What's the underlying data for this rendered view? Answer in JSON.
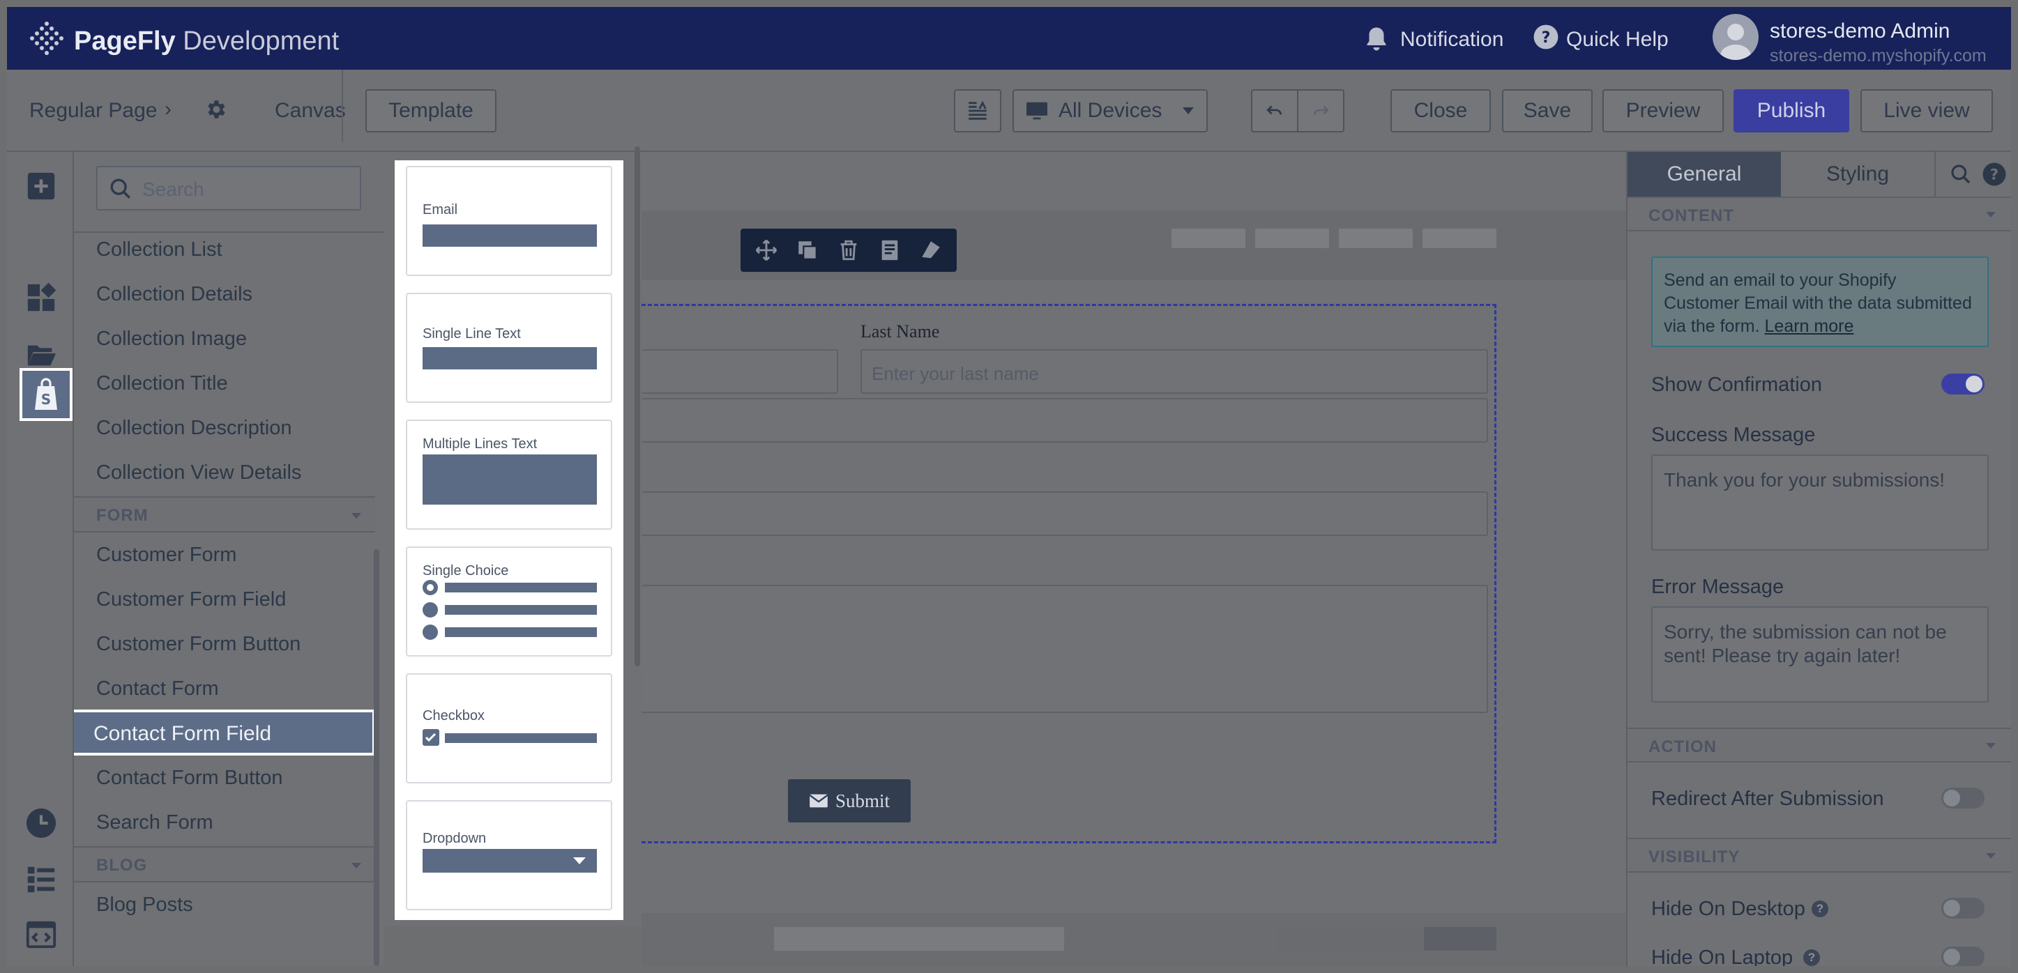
{
  "topbar": {
    "brand_bold": "PageFly",
    "brand_light": "Development",
    "notification_label": "Notification",
    "quick_help_label": "Quick Help",
    "user_name": "stores-demo Admin",
    "user_store": "stores-demo.myshopify.com"
  },
  "toolbar": {
    "breadcrumb_page": "Regular Page",
    "breadcrumb_separator": "›",
    "breadcrumb_canvas": "Canvas",
    "template_label": "Template",
    "devices_label": "All Devices",
    "close_label": "Close",
    "save_label": "Save",
    "preview_label": "Preview",
    "publish_label": "Publish",
    "live_view_label": "Live view"
  },
  "element_panel": {
    "search_placeholder": "Search",
    "items_top": [
      "Collection List",
      "Collection Details",
      "Collection Image",
      "Collection Title",
      "Collection Description",
      "Collection View Details"
    ],
    "form_section": "FORM",
    "form_items": [
      "Customer Form",
      "Customer Form Field",
      "Customer Form Button",
      "Contact Form",
      "Contact Form Field",
      "Contact Form Button",
      "Search Form"
    ],
    "selected_item": "Contact Form Field",
    "blog_section": "BLOG",
    "blog_items": [
      "Blog Posts"
    ]
  },
  "field_picker": {
    "cards": [
      "Email",
      "Single Line Text",
      "Multiple Lines Text",
      "Single Choice",
      "Checkbox",
      "Dropdown"
    ]
  },
  "canvas": {
    "last_name_label": "Last Name",
    "last_name_placeholder": "Enter your last name",
    "submit_label": "Submit"
  },
  "right_panel": {
    "tab_general": "General",
    "tab_styling": "Styling",
    "content_section": "CONTENT",
    "info_text": "Send an email to your Shopify Customer Email with the data submitted via the form.",
    "info_link": "Learn more",
    "show_confirmation_label": "Show Confirmation",
    "show_confirmation_on": true,
    "success_message_label": "Success Message",
    "success_message_value": "Thank you for your submissions!",
    "error_message_label": "Error Message",
    "error_message_value": "Sorry, the submission can not be sent! Please try again later!",
    "action_section": "ACTION",
    "redirect_label": "Redirect After Submission",
    "visibility_section": "VISIBILITY",
    "hide_desktop_label": "Hide On Desktop",
    "hide_laptop_label": "Hide On Laptop"
  }
}
